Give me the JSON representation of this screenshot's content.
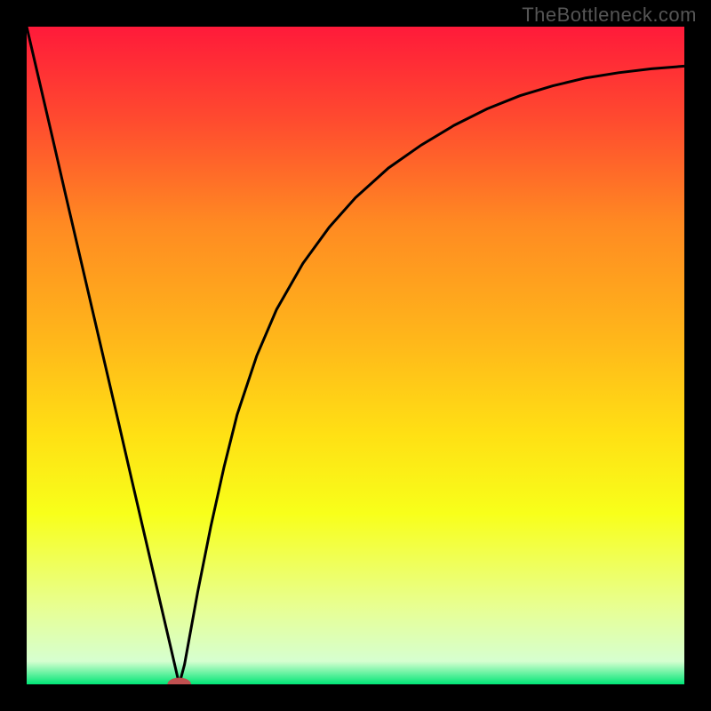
{
  "watermark": "TheBottleneck.com",
  "chart_data": {
    "type": "line",
    "title": "",
    "xlabel": "",
    "ylabel": "",
    "xlim": [
      0,
      100
    ],
    "ylim": [
      0,
      100
    ],
    "grid": false,
    "legend": false,
    "background_gradient": {
      "stops": [
        {
          "offset": 0.0,
          "color": "#ff1a3a"
        },
        {
          "offset": 0.14,
          "color": "#ff4a2f"
        },
        {
          "offset": 0.3,
          "color": "#ff8a22"
        },
        {
          "offset": 0.48,
          "color": "#ffb81a"
        },
        {
          "offset": 0.62,
          "color": "#ffe014"
        },
        {
          "offset": 0.74,
          "color": "#f8ff1a"
        },
        {
          "offset": 0.88,
          "color": "#e8ff90"
        },
        {
          "offset": 0.965,
          "color": "#d6ffd0"
        },
        {
          "offset": 1.0,
          "color": "#00e676"
        }
      ]
    },
    "series": [
      {
        "name": "bottleneck-curve",
        "color": "#000000",
        "x": [
          0.0,
          2.0,
          4.0,
          6.0,
          8.0,
          10.0,
          12.0,
          14.0,
          16.0,
          18.0,
          20.0,
          22.0,
          23.2,
          24.0,
          26.0,
          28.0,
          30.0,
          32.0,
          35.0,
          38.0,
          42.0,
          46.0,
          50.0,
          55.0,
          60.0,
          65.0,
          70.0,
          75.0,
          80.0,
          85.0,
          90.0,
          95.0,
          100.0
        ],
        "y": [
          100.0,
          91.4,
          82.8,
          74.1,
          65.5,
          56.9,
          48.3,
          39.7,
          31.0,
          22.4,
          13.8,
          5.2,
          0.0,
          3.0,
          14.0,
          24.0,
          33.0,
          41.0,
          50.0,
          57.0,
          64.0,
          69.5,
          74.0,
          78.5,
          82.0,
          85.0,
          87.5,
          89.5,
          91.0,
          92.2,
          93.0,
          93.6,
          94.0
        ]
      }
    ],
    "marker": {
      "name": "optimum-point",
      "x": 23.2,
      "y": 0.0,
      "color": "#c05050",
      "rx": 1.8,
      "ry": 1.0
    }
  }
}
